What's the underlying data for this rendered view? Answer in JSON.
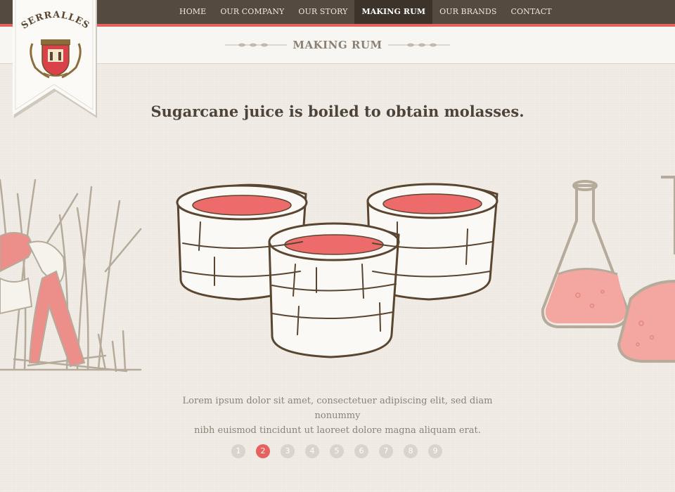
{
  "nav": {
    "items": [
      {
        "label": "HOME",
        "name": "nav-home"
      },
      {
        "label": "OUR COMPANY",
        "name": "nav-our-company"
      },
      {
        "label": "OUR STORY",
        "name": "nav-our-story"
      },
      {
        "label": "MAKING RUM",
        "name": "nav-making-rum",
        "active": true
      },
      {
        "label": "OUR BRANDS",
        "name": "nav-our-brands"
      },
      {
        "label": "CONTACT",
        "name": "nav-contact"
      }
    ]
  },
  "brand": {
    "name": "SERRALLES"
  },
  "page": {
    "title": "MAKING RUM"
  },
  "slide": {
    "headline": "Sugarcane juice is boiled to obtain molasses.",
    "caption_line1": "Lorem ipsum dolor sit amet, consectetuer adipiscing elit, sed diam nonummy",
    "caption_line2": "nibh euismod tincidunt ut laoreet dolore magna aliquam erat."
  },
  "pager": {
    "pages": [
      "1",
      "2",
      "3",
      "4",
      "5",
      "6",
      "7",
      "8",
      "9"
    ],
    "current": "2"
  },
  "colors": {
    "nav_bg": "#544a3f",
    "nav_active_bg": "#3c342b",
    "accent_red": "#e5625f",
    "ink_brown": "#5a4630",
    "muted_taupe": "#b6ab9b",
    "liquid_pink": "#f0a09a",
    "page_bg": "#f1ede6"
  }
}
